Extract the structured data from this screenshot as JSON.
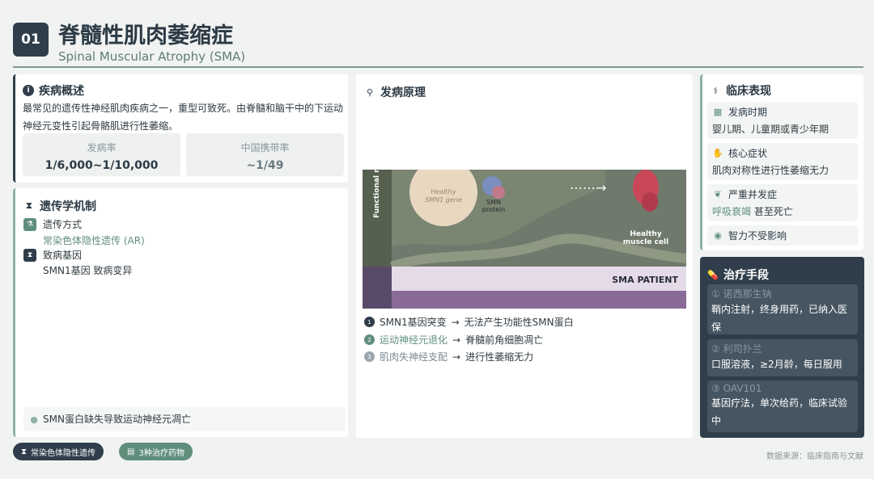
{
  "header": {
    "number": "01",
    "title_zh": "脊髓性肌肉萎缩症",
    "title_en": "Spinal Muscular Atrophy (SMA)"
  },
  "overview": {
    "title": "疾病概述",
    "text": "最常见的遗传性神经肌肉疾病之一，重型可致死。由脊髓和脑干中的下运动神经元变性引起骨骼肌进行性萎缩。",
    "stats": [
      {
        "label": "发病率",
        "value": "1/6,000~1/10,000"
      },
      {
        "label": "中国携带率",
        "value": "~1/49"
      }
    ]
  },
  "genetics": {
    "title": "遗传学机制",
    "inheritance_label": "遗传方式",
    "inheritance_value": "常染色体隐性遗传 (AR)",
    "gene_label": "致病基因",
    "gene_value": "SMN1基因 致病变异",
    "footer": "SMN蛋白缺失导致运动神经元凋亡"
  },
  "mechanism": {
    "title": "发病原理",
    "illustration": {
      "axis_text": "Functional m",
      "gene_label_1": "Healthy",
      "gene_label_2": "SMN1 gene",
      "protein_label_1": "SMN",
      "protein_label_2": "protein",
      "muscle_label_1": "Healthy",
      "muscle_label_2": "muscle cell",
      "patient_label": "SMA PATIENT"
    },
    "steps": [
      {
        "num": "1",
        "lead": "SMN1基因突变",
        "arrow": "→",
        "result": "无法产生功能性SMN蛋白"
      },
      {
        "num": "2",
        "lead": "运动神经元退化",
        "arrow": "→",
        "result": "脊髓前角细胞凋亡"
      },
      {
        "num": "3",
        "lead": "肌肉失神经支配",
        "arrow": "→",
        "result": "进行性萎缩无力"
      }
    ]
  },
  "clinical": {
    "title": "临床表现",
    "onset_label": "发病时期",
    "onset_value": "婴儿期、儿童期或青少年期",
    "core_label": "核心症状",
    "core_value": "肌肉对称性进行性萎缩无力",
    "complication_label": "严重并发症",
    "complication_value_highlight": "呼吸衰竭",
    "complication_value_rest": "甚至死亡",
    "intellect": "智力不受影响"
  },
  "treatment": {
    "title": "治疗手段",
    "items": [
      {
        "num": "①",
        "name": "诺西那生钠",
        "desc": "鞘内注射，终身用药，已纳入医保"
      },
      {
        "num": "②",
        "name": "利司扑兰",
        "desc": "口服溶液，≥2月龄，每日服用"
      },
      {
        "num": "③",
        "name": "OAV101",
        "desc": "基因疗法，单次给药，临床试验中"
      }
    ]
  },
  "footer": {
    "tag1": "常染色体隐性遗传",
    "tag2": "3种治疗药物",
    "source": "数据来源：临床指南与文献"
  },
  "colors": {
    "dark": "#2f3e4a",
    "accent_green": "#5f8f7c",
    "rule": "#7f9a90"
  }
}
